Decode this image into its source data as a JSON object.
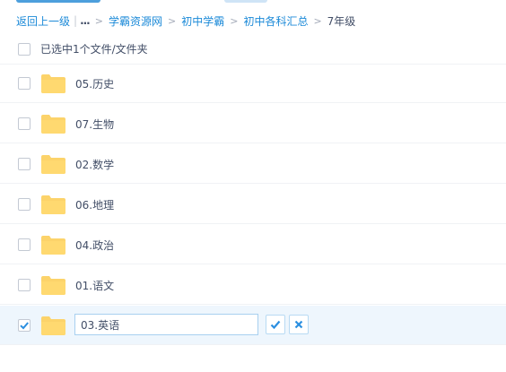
{
  "breadcrumb": {
    "back": "返回上一级",
    "ellipsis": "...",
    "items": [
      "学霸资源网",
      "初中学霸",
      "初中各科汇总"
    ],
    "current": "7年级",
    "separator": ">"
  },
  "header": {
    "selection_label": "已选中1个文件/文件夹"
  },
  "files": [
    {
      "name": "05.历史",
      "checked": false
    },
    {
      "name": "07.生物",
      "checked": false
    },
    {
      "name": "02.数学",
      "checked": false
    },
    {
      "name": "06.地理",
      "checked": false
    },
    {
      "name": "04.政治",
      "checked": false
    },
    {
      "name": "01.语文",
      "checked": false
    }
  ],
  "editing_row": {
    "value": "03.英语",
    "checked": true,
    "confirm_icon": "check-icon",
    "cancel_icon": "close-icon"
  },
  "colors": {
    "link": "#1c8ad8",
    "folder": "#fcd36a",
    "active_row": "#eef6fd",
    "check": "#2b8fe0"
  }
}
